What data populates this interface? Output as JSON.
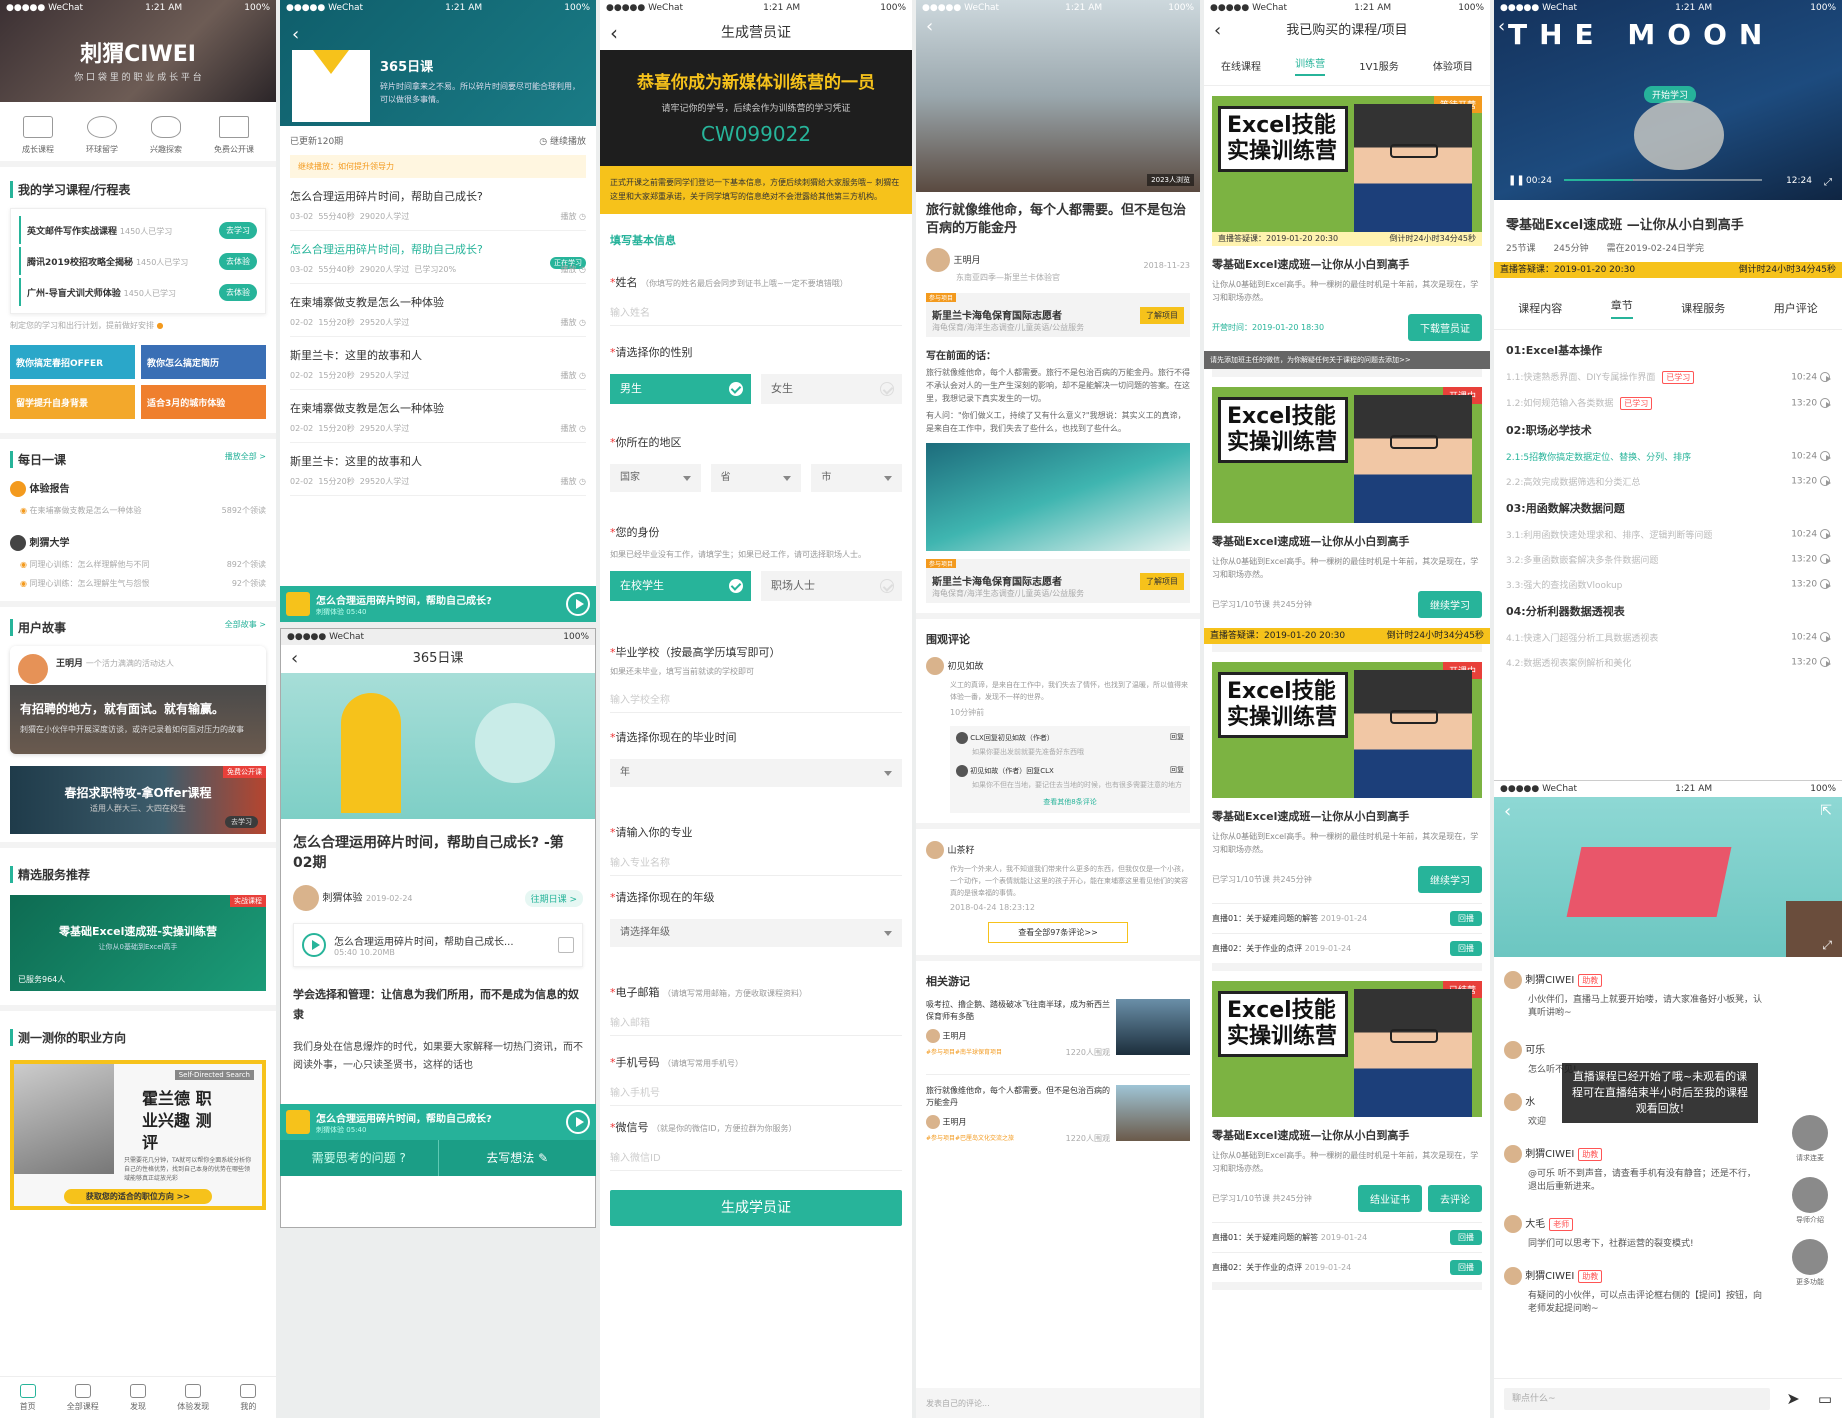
{
  "status": {
    "carrier": "●●●●● WeChat",
    "time": "1:21 AM",
    "battery": "100%"
  },
  "p1": {
    "banner_logo": "刺猬CIWEI",
    "banner_sub": "你 口 袋 里 的 职 业 成 长 平 台",
    "quick": [
      "成长课程",
      "环球留学",
      "兴趣探索",
      "免费公开课"
    ],
    "my_title": "我的学习课程/行程表",
    "my_items": [
      {
        "name": "英文邮件写作实战课程",
        "meta": "1450人已学习",
        "btn": "去学习"
      },
      {
        "name": "腾讯2019校招攻略全揭秘",
        "meta": "1450人已学习",
        "btn": "去体验"
      },
      {
        "name": "广州-导盲犬训犬师体验",
        "meta": "1450人已学习",
        "btn": "去体验"
      }
    ],
    "my_tip": "制定您的学习和出行计划，提前做好安排",
    "tiles": [
      "教你搞定春招OFFER",
      "教你怎么搞定简历",
      "留学提升自身背景",
      "适合3月的城市体验"
    ],
    "daily_title": "每日一课",
    "daily_more": "播放全部 >",
    "daily": [
      {
        "group": "体验报告",
        "items": [
          {
            "t": "在柬埔寨做支教是怎么一种体验",
            "n": "5892个领读"
          }
        ]
      },
      {
        "group": "刺猬大学",
        "items": [
          {
            "t": "同理心训练：怎么样理解他与不同",
            "n": "892个领读"
          },
          {
            "t": "同理心训练：怎么理解生气与怨恨",
            "n": "92个领读"
          }
        ]
      }
    ],
    "story_title": "用户故事",
    "story_more": "全部故事 >",
    "story_card": {
      "name": "王明月",
      "intro": "一个活力满满的活动达人",
      "big": "有招聘的地方，就有面试。就有输赢。",
      "small": "刺猬在小伙伴中开展深度访谈，或许记录着如何面对压力的故事"
    },
    "spring": {
      "tag": "免费公开课",
      "title": "春招求职特攻-拿Offer课程",
      "sub": "适用人群大三、大四在校生",
      "btn": "去学习"
    },
    "service_title": "精选服务推荐",
    "service": {
      "tag": "实战课程",
      "title": "零基础Excel速成班-实操训练营",
      "sub": "让你从0基础到Excel高手",
      "count": "已服务964人"
    },
    "career_title": "测一测你的职业方向",
    "career": {
      "en": "Self-Directed Search",
      "title": "霍兰德 职业兴趣 测评",
      "desc": "只需要花几分钟，TA就可以帮你全面系统分析你自己的性格优势，找到自己本身的优势在哪些领域能够真正绽放光彩",
      "btn": "获取您的适合的职位方向 >>"
    },
    "nav": [
      "首页",
      "全部课程",
      "发现",
      "体验发现",
      "我的"
    ]
  },
  "p2": {
    "course": "365日课",
    "desc": "碎片时间拿来之不易。所以碎片时间要尽可能合理利用，可以做很多事情。",
    "updated": "已更新120期",
    "resume": "继续播放",
    "continue": "继续播放：如何提升领导力",
    "episodes": [
      {
        "title": "怎么合理运用碎片时间，帮助自己成长?",
        "date": "03-02",
        "dur": "55分40秒",
        "count": "29020人学过",
        "extra": "",
        "act": "播放",
        "active": false
      },
      {
        "title": "怎么合理运用碎片时间，帮助自己成长?",
        "date": "03-02",
        "dur": "55分40秒",
        "count": "29020人学过",
        "extra": "已学习20%",
        "act": "播放",
        "active": true
      },
      {
        "title": "在柬埔寨做支教是怎么一种体验",
        "date": "02-02",
        "dur": "15分20秒",
        "count": "29520人学过",
        "extra": "",
        "act": "播放",
        "active": false
      },
      {
        "title": "斯里兰卡：这里的故事和人",
        "date": "02-02",
        "dur": "15分20秒",
        "count": "29520人学过",
        "extra": "",
        "act": "播放",
        "active": false
      },
      {
        "title": "在柬埔寨做支教是怎么一种体验",
        "date": "02-02",
        "dur": "15分20秒",
        "count": "29520人学过",
        "extra": "",
        "act": "播放",
        "active": false
      },
      {
        "title": "斯里兰卡：这里的故事和人",
        "date": "02-02",
        "dur": "15分20秒",
        "count": "29520人学过",
        "extra": "",
        "act": "播放",
        "active": false
      }
    ],
    "active_tag": "正在学习",
    "mini": {
      "title": "怎么合理运用碎片时间，帮助自己成长?",
      "sub": "刺猬体验",
      "time": "05:40"
    },
    "detail": {
      "nav": "365日课",
      "title": "怎么合理运用碎片时间，帮助自己成长? -第02期",
      "author": "刺猬体验",
      "date": "2019-02-24",
      "past": "往期日课 >",
      "audio": "怎么合理运用碎片时间，帮助自己成长...",
      "audio_meta": "05:40 10.20MB",
      "quote": "学会选择和管理：让信息为我们所用，而不是成为信息的奴隶",
      "body": "我们身处在信息爆炸的时代，如果要大家解释一切热门资讯，而不阅读外事，一心只读圣贤书，这样的话也"
    },
    "bottom": {
      "q": "需要思考的问题",
      "w": "去写想法"
    }
  },
  "p3": {
    "nav": "生成营员证",
    "headline": "恭喜你成为新媒体训练营的一员",
    "sub": "请牢记你的学号，后续会作为训练营的学习凭证",
    "code": "CW099022",
    "note": "正式开课之前需要同学们登记一下基本信息，方便后续刺猬给大家服务哦~ 刺猬在这里和大家郑重承诺，关于同学填写的信息绝对不会泄露给其他第三方机构。",
    "section": "填写基本信息",
    "name_label": "姓名",
    "name_hint": "（你填写的姓名最后会同步到证书上哦~一定不要填错哦）",
    "name_ph": "输入姓名",
    "gender_label": "请选择你的性别",
    "male": "男生",
    "female": "女生",
    "region_label": "你所在的地区",
    "region": [
      "国家",
      "省",
      "市"
    ],
    "identity_label": "您的身份",
    "identity_hint": "如果已经毕业没有工作，请填学生；如果已经工作，请可选择职场人士。",
    "student": "在校学生",
    "worker": "职场人士",
    "school_label": "毕业学校（按最高学历填写即可）",
    "school_hint": "如果还未毕业，填写当前就读的学校即可",
    "school_ph": "输入学校全称",
    "grad_label": "请选择你现在的毕业时间",
    "grad_ph": "年",
    "major_label": "请输入你的专业",
    "major_ph": "输入专业名称",
    "grade_label": "请选择你现在的年级",
    "grade_ph": "请选择年级",
    "email_label": "电子邮箱",
    "email_hint": "（请填写常用邮箱，方便收取课程资料）",
    "email_ph": "输入邮箱",
    "phone_label": "手机号码",
    "phone_hint": "（请填写常用手机号）",
    "phone_ph": "输入手机号",
    "wx_label": "微信号",
    "wx_hint": "（就是你的微信ID，方便拉群为你服务）",
    "wx_ph": "输入微信ID",
    "submit": "生成学员证"
  },
  "p4": {
    "photo_badge": "2023人浏览",
    "title": "旅行就像维他命，每个人都需要。但不是包治百病的万能金丹",
    "author": "王明月",
    "author_sub": "东南亚四季—斯里兰卡体验官",
    "date": "2018-11-23",
    "project_tag": "参与项目",
    "project": "斯里兰卡海龟保育国际志愿者",
    "project_sub": "海龟保育/海洋生态调查/儿童英语/公益服务",
    "project_btn": "了解项目",
    "preface_title": "写在前面的话：",
    "preface": "旅行就像维他命，每个人都需要。旅行不是包治百病的万能金丹。旅行不得不承认会对人的一生产生深刻的影响，却不是能解决一切问题的答案。在这里，我想记录下真实发生的一切。",
    "preface2": "有人问：\"你们做义工，持续了又有什么意义?\"我想说：其实义工的真谛，是来自在工作中，我们失去了些什么，也找到了些什么。",
    "comments_title": "围观评论",
    "c1": {
      "name": "初见如故",
      "text": "义工的真谛，是来自在工作中，我们失去了情怀，也找到了温暖，所以值得来体验一番，发现不一样的世界。",
      "time": "10分钟前"
    },
    "reply1": {
      "who": "CLX回复初见如故（作者）",
      "text": "如果你要出发前就要先准备好东西哦",
      "act": "回复"
    },
    "reply2": {
      "who": "初见如故（作者）回复CLX",
      "text": "如果你不但在当地，要记住去当地的时候，也有很多需要注意的地方",
      "act": "回复"
    },
    "more_replies": "查看其他8条评论",
    "c2": {
      "name": "山茶籽",
      "text": "作为一个外来人，我不知道我们带来什么更多的东西，但我仅仅是一个小孩，一个动作，一个表情就能让这里的孩子开心，能在柬埔寨这里看见他们的笑容真的是很幸福的事情。",
      "time": "2018-04-24 18:23:12"
    },
    "all_comments": "查看全部97条评论>>",
    "related_title": "相关游记",
    "related": [
      {
        "title": "吸考拉、撸企鹅、踏极破冰飞往南半球，成为新西兰保育师有多酷",
        "author": "王明月",
        "sub": "东南亚四季—斯里兰卡体验官",
        "tag": "#参与项目#南半球保育项目",
        "views": "1220人围观"
      },
      {
        "title": "旅行就像维他命，每个人都需要。但不是包治百病的万能金丹",
        "author": "王明月",
        "sub": "东南亚四季—斯里兰卡体验官",
        "tag": "#参与项目#巴厘岛文化交流之旅",
        "views": "1220人围观"
      }
    ],
    "comment_ph": "发表自己的评论..."
  },
  "p5": {
    "nav": "我已购买的课程/项目",
    "tabs": [
      "在线课程",
      "训练营",
      "1V1服务",
      "体验项目"
    ],
    "excel_title": "Excel技能 实操训练营",
    "course": "零基础Excel速成班—让你从小白到高手",
    "desc": "让你从0基础到Excel高手。种一棵树的最佳时机是十年前，其次是现在，学习和职场亦然。",
    "cards": [
      {
        "status": "等待开营",
        "bar": [
          "直播答疑课：2019-01-20 20:30",
          "倒计时24小时34分45秒"
        ],
        "meta": "开营时间：2019-01-20 18:30",
        "btns": [
          "下载营员证"
        ],
        "note": "请先添加班主任的微信，为你解疑任何关于课程的问题去添加>>"
      },
      {
        "status": "开课中",
        "bar": [],
        "meta": "已学习1/10节课   共245分钟",
        "btns": [
          "继续学习"
        ],
        "bottom": [
          "直播答疑课：2019-01-20 20:30",
          "倒计时24小时34分45秒"
        ]
      },
      {
        "status": "开课中",
        "bar": [],
        "meta": "已学习1/10节课   共245分钟",
        "btns": [
          "继续学习"
        ],
        "lives": [
          {
            "t": "直播01：关于疑难问题的解答",
            "d": "2019-01-24",
            "b": "回播"
          },
          {
            "t": "直播02：关于作业的点评",
            "d": "2019-01-24",
            "b": "回播"
          }
        ]
      },
      {
        "status": "已结营",
        "bar": [],
        "meta": "已学习1/10节课   共245分钟",
        "btns": [
          "结业证书",
          "去评论"
        ],
        "lives": [
          {
            "t": "直播01：关于疑难问题的解答",
            "d": "2019-01-24",
            "b": "回播"
          },
          {
            "t": "直播02：关于作业的点评",
            "d": "2019-01-24",
            "b": "回播"
          }
        ]
      }
    ]
  },
  "p6": {
    "video_title": "THE MOON",
    "video_btn": "开始学习",
    "time_now": "00:24",
    "time_total": "12:24",
    "progress": 0.35,
    "course": "零基础Excel速成班 —让你从小白到高手",
    "stats": [
      "25节课",
      "245分钟",
      "需在2019-02-24日学完"
    ],
    "live_bar": [
      "直播答疑课：2019-01-20  20:30",
      "倒计时24小时34分45秒"
    ],
    "tabs": [
      "课程内容",
      "章节",
      "课程服务",
      "用户评论"
    ],
    "chapters": [
      {
        "title": "01:Excel基本操作",
        "lessons": [
          {
            "t": "1.1:快速熟悉界面、DIY专属操作界面",
            "tag": "已学习",
            "d": "10:24"
          },
          {
            "t": "1.2:如何规范输入各类数据",
            "tag": "已学习",
            "d": "13:20"
          }
        ]
      },
      {
        "title": "02:职场必学技术",
        "lessons": [
          {
            "t": "2.1:5招教你搞定数据定位、替换、分列、排序",
            "tag": "",
            "d": "10:24",
            "active": true
          },
          {
            "t": "2.2:高效完成数据筛选和分类汇总",
            "tag": "",
            "d": "13:20"
          }
        ]
      },
      {
        "title": "03:用函数解决数据问题",
        "lessons": [
          {
            "t": "3.1:利用函数快速处理求和、排序、逻辑判断等问题",
            "tag": "",
            "d": "10:24"
          },
          {
            "t": "3.2:多重函数嵌套解决多条件数据问题",
            "tag": "",
            "d": "13:20"
          },
          {
            "t": "3.3:强大的查找函数Vlookup",
            "tag": "",
            "d": "13:20"
          }
        ]
      },
      {
        "title": "04:分析利器数据透视表",
        "lessons": [
          {
            "t": "4.1:快速入门超强分析工具数据透视表",
            "tag": "",
            "d": "10:24"
          },
          {
            "t": "4.2:数据透视表案例解析和美化",
            "tag": "",
            "d": "13:20"
          }
        ]
      }
    ],
    "chat": [
      {
        "name": "刺猬CIWEI",
        "role": "助教",
        "text": "小伙伴们，直播马上就要开始喽，请大家准备好小板凳，认真听讲哟~"
      },
      {
        "name": "可乐",
        "role": "",
        "text": "怎么听不见!"
      },
      {
        "name": "水",
        "role": "",
        "text": "欢迎"
      },
      {
        "name": "刺猬CIWEI",
        "role": "助教",
        "text": "@可乐 听不到声音，请查看手机有没有静音；还是不行，退出后重新进来。"
      },
      {
        "name": "大毛",
        "role": "老师",
        "text": "同学们可以思考下，社群运营的裂变模式!"
      },
      {
        "name": "刺猬CIWEI",
        "role": "助教",
        "text": "有疑问的小伙伴，可以点击评论框右侧的【提问】按钮，向老师发起提问哟~"
      }
    ],
    "toast": "直播课程已经开始了哦~未观看的课程可在直播结束半小时后至我的课程观看回放!",
    "side": [
      "请求连麦",
      "导师介绍",
      "更多功能"
    ],
    "input_ph": "聊点什么~"
  }
}
